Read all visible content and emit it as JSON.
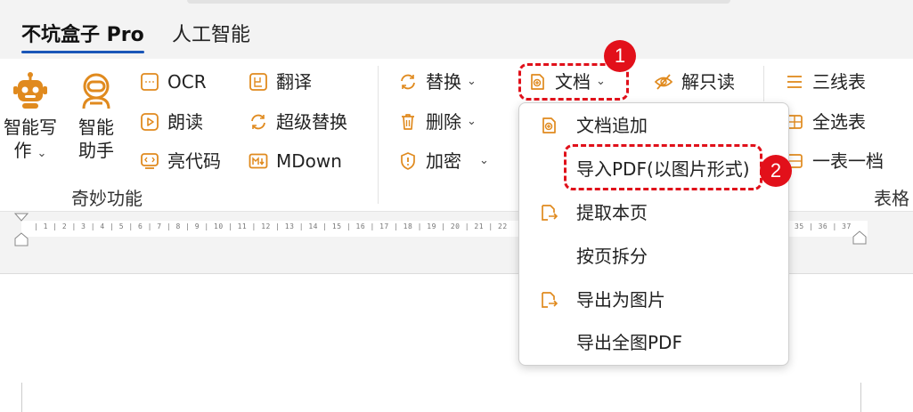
{
  "tabs": [
    {
      "label": "不坑盒子 Pro"
    },
    {
      "label": "人工智能"
    }
  ],
  "ribbon": {
    "writer": {
      "line1": "智能写",
      "line2": "作",
      "caret": "⌄"
    },
    "assistant": {
      "line1": "智能",
      "line2": "助手"
    },
    "ocr": "OCR",
    "read_aloud": "朗读",
    "code": "亮代码",
    "translate": "翻译",
    "super_replace": "超级替换",
    "mdown": "MDown",
    "group_label_magic": "奇妙功能",
    "replace": "替换",
    "delete": "删除",
    "encrypt": "加密",
    "doc": "文档",
    "unlock": "解只读",
    "three_line_table": "三线表",
    "select_all_tables": "全选表",
    "one_table_one_doc": "一表一档",
    "group_label_table": "表格",
    "caret": "⌄"
  },
  "ruler": {
    "left_numbers": "| 1 | 2 | 3 | 4 | 5 | 6 | 7 | 8 | 9 | 10 | 11 | 12 | 13 | 14 | 15 | 16 | 17 | 18 | 19 | 20 | 21 | 22",
    "right_numbers": "35 | 36 | 37"
  },
  "dropdown": {
    "items": [
      {
        "label": "文档追加",
        "icon": "doc-append-icon"
      },
      {
        "label": "导入PDF(以图片形式)",
        "icon": ""
      },
      {
        "label": "提取本页",
        "icon": "extract-page-icon"
      },
      {
        "label": "按页拆分",
        "icon": ""
      },
      {
        "label": "导出为图片",
        "icon": "export-image-icon"
      },
      {
        "label": "导出全图PDF",
        "icon": ""
      }
    ]
  },
  "markers": {
    "one": "1",
    "two": "2"
  },
  "colors": {
    "accent_orange": "#e08a1e",
    "highlight_red": "#e0101a",
    "tab_underline": "#1a56b8"
  }
}
